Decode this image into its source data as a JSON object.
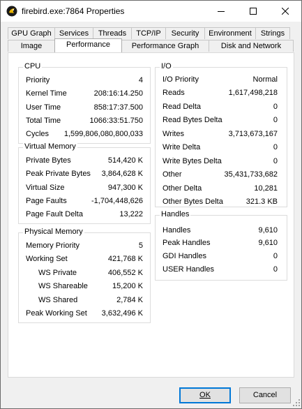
{
  "window": {
    "title": "firebird.exe:7864 Properties"
  },
  "tabs": {
    "row1": [
      "GPU Graph",
      "Services",
      "Threads",
      "TCP/IP",
      "Security",
      "Environment",
      "Strings"
    ],
    "row2": [
      "Image",
      "Performance",
      "Performance Graph",
      "Disk and Network"
    ],
    "active": "Performance"
  },
  "cpu": {
    "title": "CPU",
    "rows": [
      {
        "label": "Priority",
        "value": "4"
      },
      {
        "label": "Kernel Time",
        "value": "208:16:14.250"
      },
      {
        "label": "User Time",
        "value": "858:17:37.500"
      },
      {
        "label": "Total Time",
        "value": "1066:33:51.750"
      },
      {
        "label": "Cycles",
        "value": "1,599,806,080,800,033"
      }
    ]
  },
  "virtual_memory": {
    "title": "Virtual Memory",
    "rows": [
      {
        "label": "Private Bytes",
        "value": "514,420 K"
      },
      {
        "label": "Peak Private Bytes",
        "value": "3,864,628 K"
      },
      {
        "label": "Virtual Size",
        "value": "947,300 K"
      },
      {
        "label": "Page Faults",
        "value": "-1,704,448,626"
      },
      {
        "label": "Page Fault Delta",
        "value": "13,222"
      }
    ]
  },
  "physical_memory": {
    "title": "Physical Memory",
    "rows": [
      {
        "label": "Memory Priority",
        "value": "5"
      },
      {
        "label": "Working Set",
        "value": "421,768 K"
      },
      {
        "label": "WS Private",
        "value": "406,552 K"
      },
      {
        "label": "WS Shareable",
        "value": "15,200 K"
      },
      {
        "label": "WS Shared",
        "value": "2,784 K"
      },
      {
        "label": "Peak Working Set",
        "value": "3,632,496 K"
      }
    ]
  },
  "io": {
    "title": "I/O",
    "rows": [
      {
        "label": "I/O Priority",
        "value": "Normal"
      },
      {
        "label": "Reads",
        "value": "1,617,498,218"
      },
      {
        "label": "Read Delta",
        "value": "0"
      },
      {
        "label": "Read Bytes Delta",
        "value": "0"
      },
      {
        "label": "Writes",
        "value": "3,713,673,167"
      },
      {
        "label": "Write Delta",
        "value": "0"
      },
      {
        "label": "Write Bytes Delta",
        "value": "0"
      },
      {
        "label": "Other",
        "value": "35,431,733,682"
      },
      {
        "label": "Other Delta",
        "value": "10,281"
      },
      {
        "label": "Other Bytes Delta",
        "value": "321.3  KB"
      }
    ]
  },
  "handles": {
    "title": "Handles",
    "rows": [
      {
        "label": "Handles",
        "value": "9,610"
      },
      {
        "label": "Peak Handles",
        "value": "9,610"
      },
      {
        "label": "GDI Handles",
        "value": "0"
      },
      {
        "label": "USER Handles",
        "value": "0"
      }
    ]
  },
  "buttons": {
    "ok": "OK",
    "cancel": "Cancel"
  }
}
